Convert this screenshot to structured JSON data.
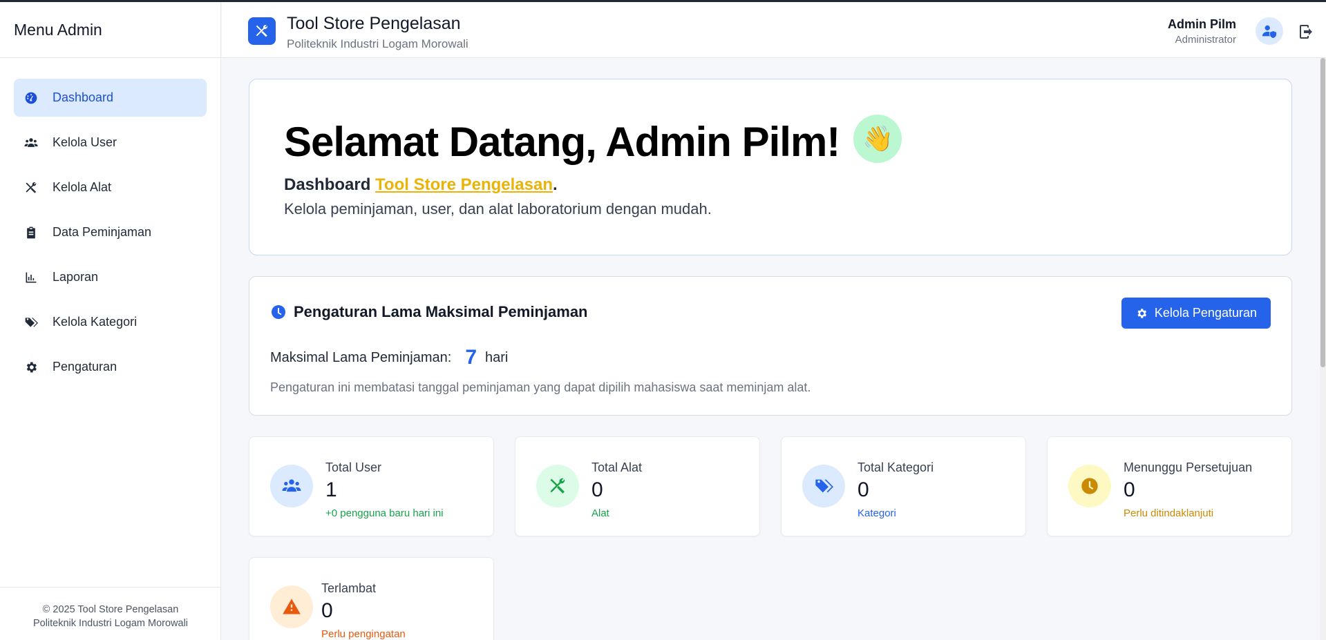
{
  "sidebar": {
    "title": "Menu Admin",
    "items": [
      {
        "label": "Dashboard",
        "icon": "gauge-icon",
        "active": true
      },
      {
        "label": "Kelola User",
        "icon": "users-icon"
      },
      {
        "label": "Kelola Alat",
        "icon": "tools-icon"
      },
      {
        "label": "Data Peminjaman",
        "icon": "clipboard-icon"
      },
      {
        "label": "Laporan",
        "icon": "chart-icon"
      },
      {
        "label": "Kelola Kategori",
        "icon": "tags-icon"
      },
      {
        "label": "Pengaturan",
        "icon": "gear-icon"
      }
    ],
    "footer_line1": "© 2025 Tool Store Pengelasan",
    "footer_line2": "Politeknik Industri Logam Morowali"
  },
  "header": {
    "title": "Tool Store Pengelasan",
    "subtitle": "Politeknik Industri Logam Morowali",
    "user_name": "Admin Pilm",
    "user_role": "Administrator"
  },
  "welcome": {
    "heading": "Selamat Datang, Admin Pilm!",
    "emoji": "👋",
    "line1_prefix": "Dashboard ",
    "line1_highlight": "Tool Store Pengelasan",
    "line1_suffix": ".",
    "line2": "Kelola peminjaman, user, dan alat laboratorium dengan mudah."
  },
  "settings": {
    "title": "Pengaturan Lama Maksimal Peminjaman",
    "button_label": "Kelola Pengaturan",
    "max_label": "Maksimal Lama Peminjaman:",
    "max_value": "7",
    "max_unit": "hari",
    "note": "Pengaturan ini membatasi tanggal peminjaman yang dapat dipilih mahasiswa saat meminjam alat."
  },
  "stats": [
    {
      "label": "Total User",
      "value": "1",
      "sub": "+0 pengguna baru hari ini",
      "icon": "users-icon",
      "color": "#2563eb",
      "bg": "#dbeafe",
      "sub_color": "#16a34a"
    },
    {
      "label": "Total Alat",
      "value": "0",
      "sub": "Alat",
      "icon": "tools-icon",
      "color": "#16a34a",
      "bg": "#dcfce7",
      "sub_color": "#16a34a"
    },
    {
      "label": "Total Kategori",
      "value": "0",
      "sub": "Kategori",
      "icon": "tags-icon",
      "color": "#2563eb",
      "bg": "#dbeafe",
      "sub_color": "#2563eb"
    },
    {
      "label": "Menunggu Persetujuan",
      "value": "0",
      "sub": "Perlu ditindaklanjuti",
      "icon": "clock-icon",
      "color": "#ca8a04",
      "bg": "#fef9c3",
      "sub_color": "#ca8a04"
    },
    {
      "label": "Terlambat",
      "value": "0",
      "sub": "Perlu pengingatan",
      "icon": "warning-icon",
      "color": "#ea580c",
      "bg": "#ffedd5",
      "sub_color": "#ea580c"
    }
  ]
}
